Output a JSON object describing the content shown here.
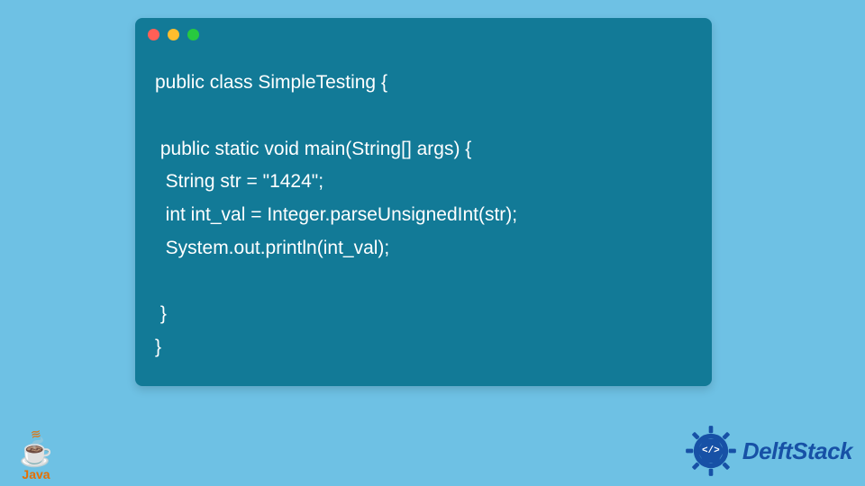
{
  "code": {
    "lines": [
      "public class SimpleTesting {",
      "",
      " public static void main(String[] args) {",
      "  String str = \"1424\";",
      "  int int_val = Integer.parseUnsignedInt(str);",
      "  System.out.println(int_val);",
      "  ",
      " }",
      "}"
    ]
  },
  "logos": {
    "java_text": "Java",
    "delftstack_text": "DelftStack",
    "delftstack_badge": "</>"
  }
}
